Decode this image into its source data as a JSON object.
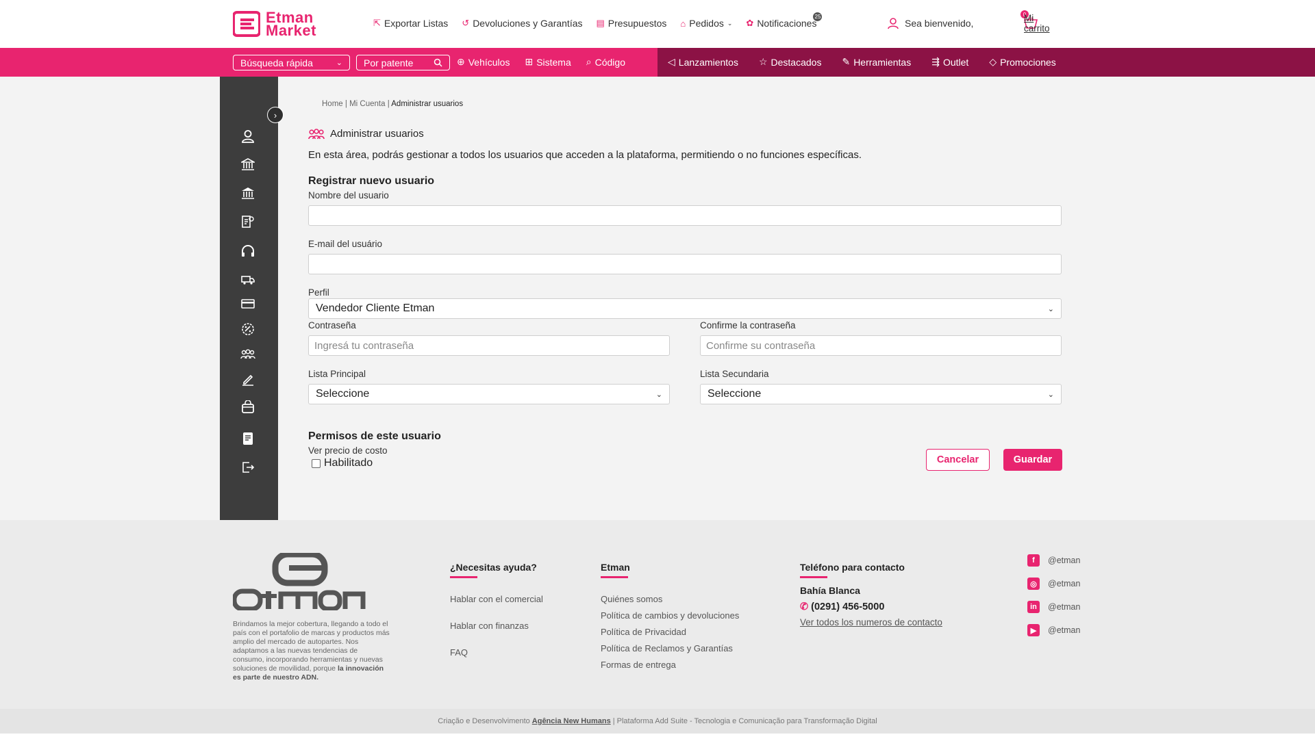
{
  "header": {
    "logo_line1": "Etman",
    "logo_line2": "Market",
    "nav": [
      {
        "label": "Exportar Listas",
        "icon": "export-icon"
      },
      {
        "label": "Devoluciones y Garantías",
        "icon": "return-icon"
      },
      {
        "label": "Presupuestos",
        "icon": "budget-icon"
      },
      {
        "label": "Pedidos",
        "icon": "orders-icon"
      },
      {
        "label": "Notificaciones",
        "icon": "bell-icon"
      }
    ],
    "notifications_count": "25",
    "welcome": "Sea bienvenido,",
    "cart_label": "Mi carrito",
    "cart_count": "0"
  },
  "pinknav": {
    "quick_search": "Búsqueda rápida",
    "by_plate": "Por patente",
    "left_links": [
      "Vehículos",
      "Sistema",
      "Código"
    ],
    "right_links": [
      "Lanzamientos",
      "Destacados",
      "Herramientas",
      "Outlet",
      "Promociones"
    ]
  },
  "breadcrumb": {
    "home": "Home",
    "account": "Mi Cuenta",
    "current": "Administrar usuarios",
    "sep": " | "
  },
  "page": {
    "title": "Administrar usuarios",
    "description": "En esta área, podrás gestionar a todos los usuarios que acceden a la plataforma, permitiendo o no funciones específicas."
  },
  "form": {
    "section_title": "Registrar nuevo usuario",
    "name_label": "Nombre del usuario",
    "name_value": "",
    "email_label": "E-mail del usuário",
    "email_value": "",
    "profile_label": "Perfil",
    "profile_value": "Vendedor Cliente Etman",
    "password_label": "Contraseña",
    "password_placeholder": "Ingresá tu contraseña",
    "confirm_label": "Confirme la contraseña",
    "confirm_placeholder": "Confirme su contraseña",
    "list_main_label": "Lista Principal",
    "list_main_value": "Seleccione",
    "list_secondary_label": "Lista Secundaria",
    "list_secondary_value": "Seleccione",
    "permissions_title": "Permisos de este usuario",
    "cost_price_label": "Ver precio de costo",
    "enabled_label": "Habilitado",
    "cancel_label": "Cancelar",
    "save_label": "Guardar"
  },
  "footer": {
    "about_text": "Brindamos la mejor cobertura, llegando a todo el país con el portafolio de marcas y productos más amplio del mercado de autopartes. Nos adaptamos a las nuevas tendencias de consumo, incorporando herramientas y nuevas soluciones de movilidad, porque",
    "about_bold": "la innovación es parte de nuestro ADN.",
    "help_title": "¿Necesitas ayuda?",
    "help_links": [
      "Hablar con el comercial",
      "Hablar con finanzas",
      "FAQ"
    ],
    "etman_title": "Etman",
    "etman_links": [
      "Quiénes somos",
      "Política de cambios y devoluciones",
      "Política de Privacidad",
      "Política de Reclamos y Garantías",
      "Formas de entrega"
    ],
    "contact_title": "Teléfono para contacto",
    "city": "Bahía Blanca",
    "phone": "(0291) 456-5000",
    "all_numbers": "Ver todos los numeros de contacto",
    "social": [
      {
        "handle": "@etman",
        "icon": "facebook-icon",
        "glyph": "f"
      },
      {
        "handle": "@etman",
        "icon": "instagram-icon",
        "glyph": "◎"
      },
      {
        "handle": "@etman",
        "icon": "linkedin-icon",
        "glyph": "in"
      },
      {
        "handle": "@etman",
        "icon": "youtube-icon",
        "glyph": "▶"
      }
    ],
    "credit_prefix": "Criação e Desenvolvimento",
    "credit_agency": "Agência New Humans",
    "credit_suffix": "| Plataforma Add Suite - Tecnologia e Comunicação para Transformação Digital"
  },
  "colors": {
    "accent": "#e8246f",
    "accent_dark": "#8c1245",
    "sidebar": "#3d3d3d"
  }
}
